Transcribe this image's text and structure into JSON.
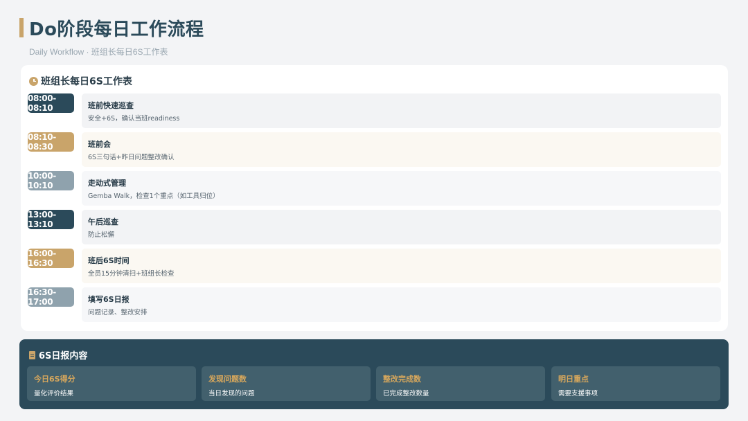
{
  "header": {
    "title": "Do阶段每日工作流程",
    "subtitle": "Daily Workflow · 班组长每日6S工作表"
  },
  "schedule": {
    "title": "班组长每日6S工作表",
    "icon": "clock-icon",
    "rows": [
      {
        "time": "08:00-08:10",
        "title": "班前快速巡查",
        "desc": "安全+6S，确认当班readiness",
        "badge_color": "#2b4a5a",
        "bg": "#f2f3f5"
      },
      {
        "time": "08:10-08:30",
        "title": "班前会",
        "desc": "6S三句话+昨日问题整改确认",
        "badge_color": "#c9a46a",
        "bg": "#fbf8f2"
      },
      {
        "time": "10:00-10:10",
        "title": "走动式管理",
        "desc": "Gemba Walk，检查1个重点（如工具归位）",
        "badge_color": "#8fa2ad",
        "bg": "#f6f7f9"
      },
      {
        "time": "13:00-13:10",
        "title": "午后巡查",
        "desc": "防止松懈",
        "badge_color": "#2b4a5a",
        "bg": "#f2f3f5"
      },
      {
        "time": "16:00-16:30",
        "title": "班后6S时间",
        "desc": "全员15分钟清扫+班组长检查",
        "badge_color": "#c9a46a",
        "bg": "#fbf8f2"
      },
      {
        "time": "16:30-17:00",
        "title": "填写6S日报",
        "desc": "问题记录、整改安排",
        "badge_color": "#8fa2ad",
        "bg": "#f6f7f9"
      }
    ]
  },
  "report": {
    "title": "6S日报内容",
    "icon": "document-icon",
    "items": [
      {
        "title": "今日6S得分",
        "desc": "量化评价结果"
      },
      {
        "title": "发现问题数",
        "desc": "当日发现的问题"
      },
      {
        "title": "整改完成数",
        "desc": "已完成整改数量"
      },
      {
        "title": "明日重点",
        "desc": "需要支援事项"
      }
    ]
  }
}
